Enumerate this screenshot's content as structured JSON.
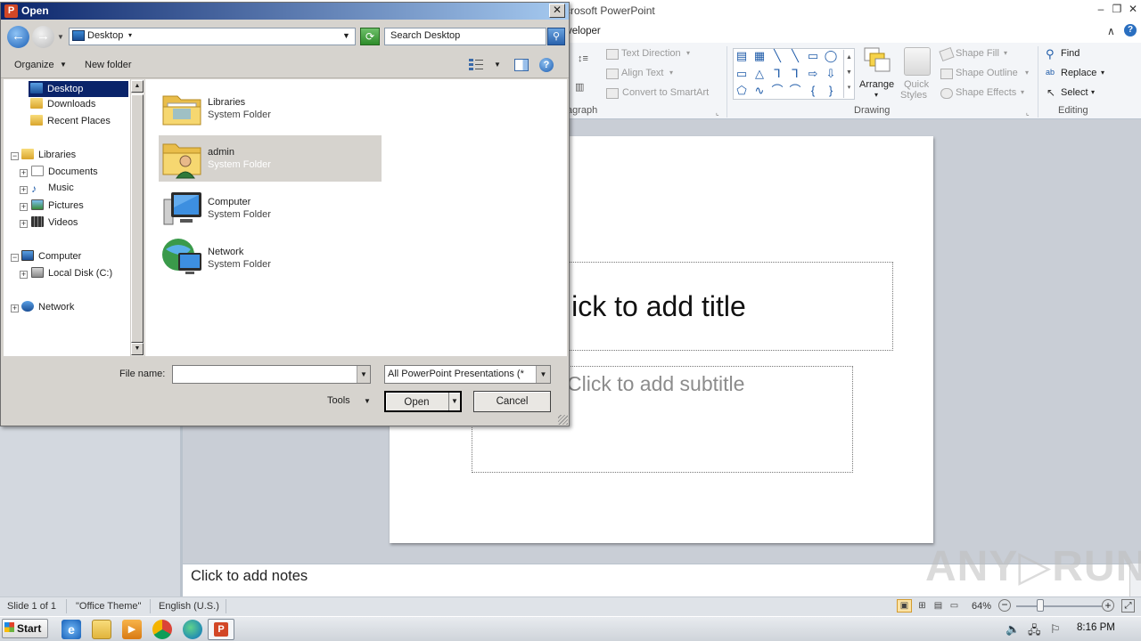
{
  "powerpoint": {
    "title_partial": "crosoft PowerPoint",
    "tab_partial": "veloper",
    "help_glyph": "?",
    "collapse_glyph": "∧",
    "window_controls": [
      "–",
      "❐",
      "✕"
    ],
    "ribbon": {
      "paragraph": {
        "label_partial": "agraph",
        "text_direction": "Text Direction",
        "align_text": "Align Text",
        "convert_smartart": "Convert to SmartArt"
      },
      "drawing": {
        "label": "Drawing",
        "arrange": "Arrange",
        "quick_styles_line1": "Quick",
        "quick_styles_line2": "Styles",
        "shape_fill": "Shape Fill",
        "shape_outline": "Shape Outline",
        "shape_effects": "Shape Effects",
        "shapes": [
          "▤",
          "▦",
          "╲",
          "╲",
          "▭",
          "◯",
          "▭",
          "△",
          "⅂",
          "⅂",
          "⇨",
          "⇩",
          "⬠",
          "∿",
          "⌒",
          "⌒",
          "{",
          "}"
        ]
      },
      "editing": {
        "label": "Editing",
        "find": "Find",
        "replace": "Replace",
        "select": "Select"
      }
    },
    "slide": {
      "title_placeholder_partial": "lick to add title",
      "subtitle_placeholder_partial": "Click to add subtitle"
    },
    "notes_placeholder": "Click to add notes",
    "status": {
      "slide_counter": "Slide 1 of 1",
      "theme": "\"Office Theme\"",
      "language": "English (U.S.)",
      "zoom": "64%",
      "zoom_level_percent": 64
    }
  },
  "watermark": "ANY▷RUN",
  "taskbar": {
    "start_label": "Start",
    "clock": "8:16 PM",
    "tray_icons": [
      "speaker-icon",
      "network-icon",
      "flag-icon"
    ]
  },
  "open_dialog": {
    "title": "Open",
    "title_icon_letter": "P",
    "close_glyph": "✕",
    "address_location": "Desktop",
    "search_placeholder": "Search Desktop",
    "toolbar": {
      "organize": "Organize",
      "new_folder": "New folder",
      "help_glyph": "?"
    },
    "nav_tree": [
      {
        "label": "Desktop",
        "selected": true,
        "icon": "desktop-icon"
      },
      {
        "label": "Downloads",
        "icon": "downloads-icon"
      },
      {
        "label": "Recent Places",
        "icon": "recent-places-icon"
      },
      {
        "label": "Libraries",
        "icon": "libraries-icon",
        "expander": "−"
      },
      {
        "label": "Documents",
        "icon": "documents-icon",
        "expander": "+"
      },
      {
        "label": "Music",
        "icon": "music-icon",
        "expander": "+"
      },
      {
        "label": "Pictures",
        "icon": "pictures-icon",
        "expander": "+"
      },
      {
        "label": "Videos",
        "icon": "videos-icon",
        "expander": "+"
      },
      {
        "label": "Computer",
        "icon": "computer-icon",
        "expander": "−"
      },
      {
        "label": "Local Disk (C:)",
        "icon": "local-disk-icon",
        "expander": "+"
      },
      {
        "label": "Network",
        "icon": "network-icon",
        "expander": "+"
      }
    ],
    "files": [
      {
        "name": "Libraries",
        "type": "System Folder",
        "icon": "libraries-folder-icon"
      },
      {
        "name": "admin",
        "type": "System Folder",
        "icon": "user-folder-icon",
        "selected": true
      },
      {
        "name": "Computer",
        "type": "System Folder",
        "icon": "computer-icon"
      },
      {
        "name": "Network",
        "type": "System Folder",
        "icon": "network-globe-icon"
      }
    ],
    "file_name_label": "File name:",
    "file_name_value": "",
    "file_type": "All PowerPoint Presentations (*",
    "tools": "Tools",
    "open_button": "Open",
    "cancel_button": "Cancel"
  }
}
